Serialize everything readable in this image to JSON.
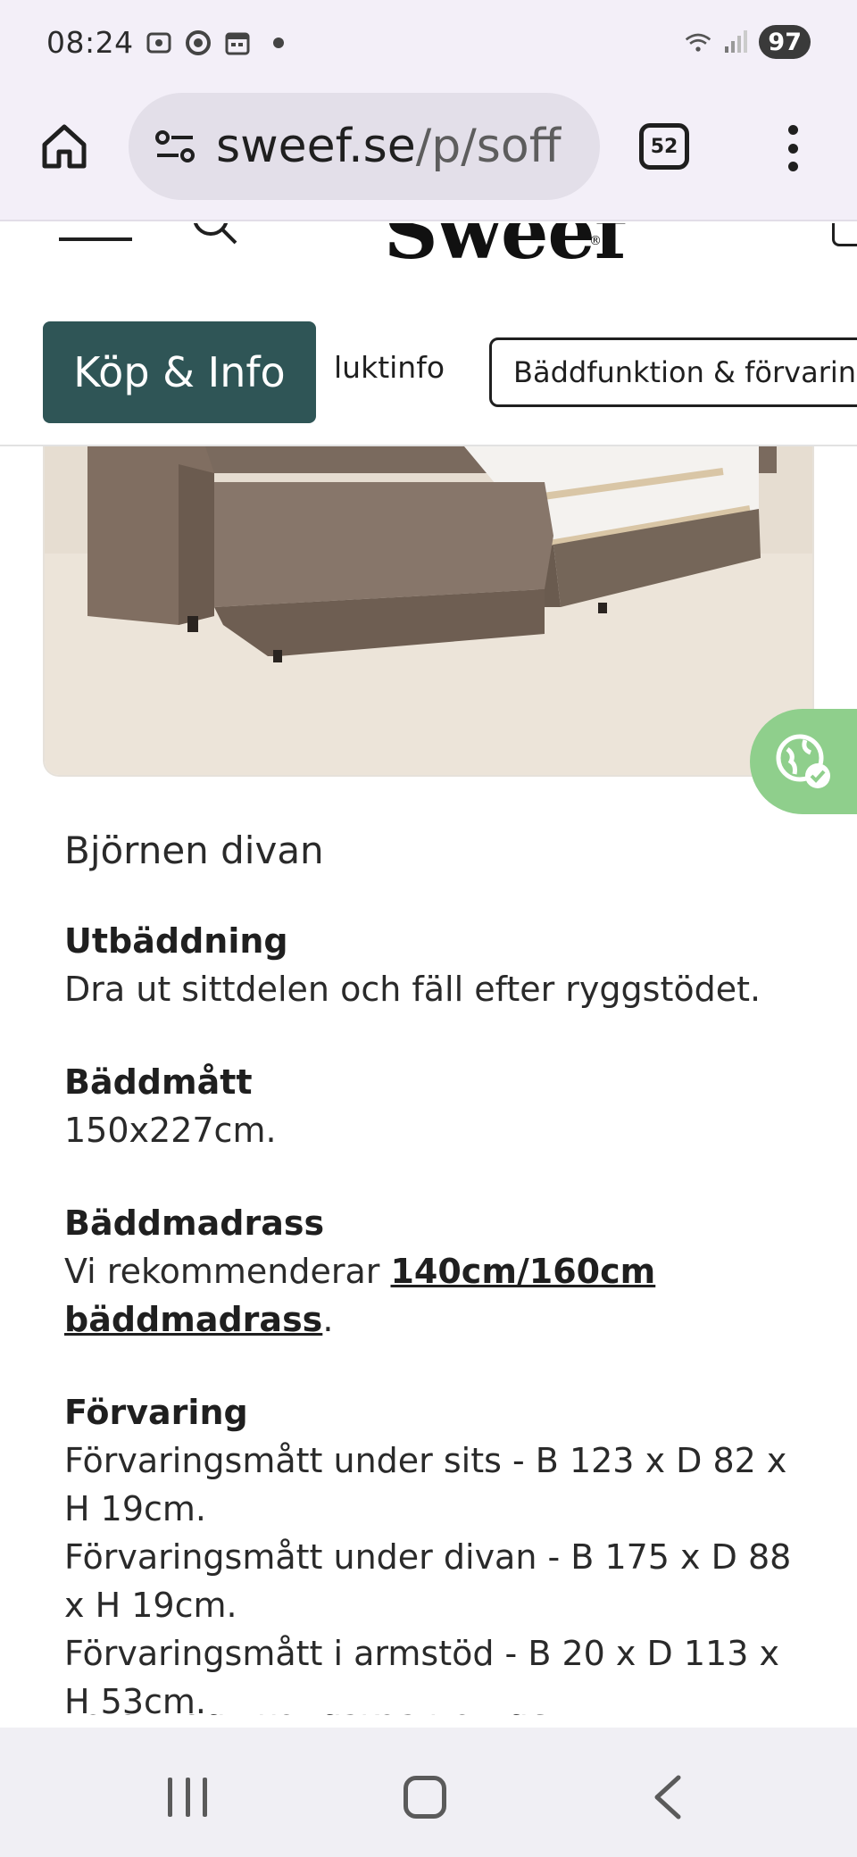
{
  "status_bar": {
    "time": "08:24",
    "battery": "97",
    "icons": [
      "screenshot-icon",
      "circle-record-icon",
      "calendar-icon",
      "notification-dot",
      "wifi-icon",
      "signal-icon"
    ]
  },
  "browser": {
    "url_host": "sweef.se",
    "url_path": "/p/soff",
    "tab_count": "52"
  },
  "site": {
    "logo": "Sweef",
    "logo_mark": "®"
  },
  "tabs": {
    "buy_info": "Köp & Info",
    "product_info": "luktinfo",
    "bed_function": "Bäddfunktion & förvaring"
  },
  "product": {
    "title": "Björnen divan",
    "specs": [
      {
        "label": "Utbäddning",
        "text": "Dra ut sittdelen och fäll efter ryggstödet."
      },
      {
        "label": "Bäddmått",
        "text": "150x227cm."
      },
      {
        "label": "Bäddmadrass",
        "text_before": "Vi rekommenderar ",
        "link": "140cm/160cm bäddmadrass",
        "text_after": "."
      },
      {
        "label": "Förvaring",
        "lines": [
          "Förvaringsmått under sits - B 123 x D 82 x H 19cm.",
          "Förvaringsmått under divan - B 175 x D 88 x H 19cm.",
          "Förvaringsmått i armstöd - B 20 x D 113 x H 53cm.",
          "Våra ...ådinhandskas från det i..."
        ]
      }
    ]
  },
  "colors": {
    "accent": "#2f5556",
    "eco_badge": "#8fcf8c",
    "browser_bg": "#f3eff8"
  }
}
